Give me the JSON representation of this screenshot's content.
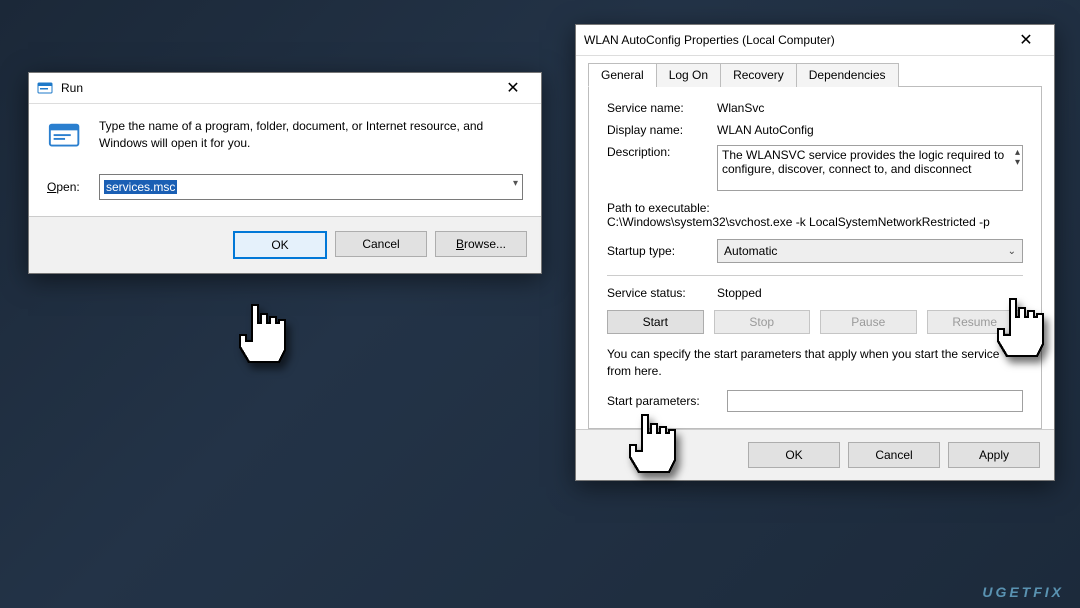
{
  "run": {
    "title": "Run",
    "hint": "Type the name of a program, folder, document, or Internet resource, and Windows will open it for you.",
    "open_label_letter": "O",
    "open_label_rest": "pen:",
    "input_value": "services.msc",
    "buttons": {
      "ok": "OK",
      "cancel": "Cancel",
      "browse_letter": "B",
      "browse_rest": "rowse..."
    }
  },
  "props": {
    "title": "WLAN AutoConfig Properties (Local Computer)",
    "tabs": [
      "General",
      "Log On",
      "Recovery",
      "Dependencies"
    ],
    "labels": {
      "service_name": "Service name:",
      "display_name": "Display name:",
      "description": "Description:",
      "path": "Path to executable:",
      "startup_type": "Startup type:",
      "service_status": "Service status:",
      "hint": "You can specify the start parameters that apply when you start the service from here.",
      "start_params": "Start parameters:"
    },
    "values": {
      "service_name": "WlanSvc",
      "display_name": "WLAN AutoConfig",
      "description": "The WLANSVC service provides the logic required to configure, discover, connect to, and disconnect",
      "path": "C:\\Windows\\system32\\svchost.exe -k LocalSystemNetworkRestricted -p",
      "startup_type": "Automatic",
      "service_status": "Stopped",
      "start_params": ""
    },
    "svc_buttons": {
      "start": "Start",
      "stop": "Stop",
      "pause": "Pause",
      "resume": "Resume"
    },
    "footer": {
      "ok": "OK",
      "cancel": "Cancel",
      "apply": "Apply"
    }
  },
  "watermark": "UGETFIX"
}
